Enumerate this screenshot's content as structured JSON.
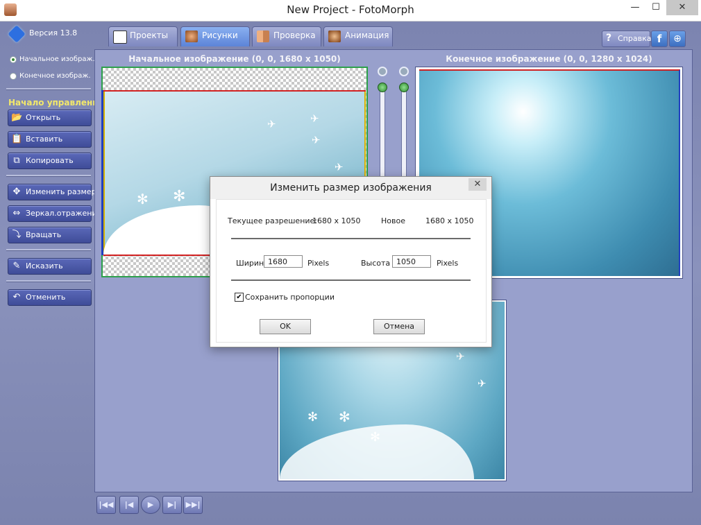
{
  "window": {
    "title": "New Project - FotoMorph",
    "minimize_glyph": "—",
    "maximize_glyph": "☐",
    "close_glyph": "✕"
  },
  "sidebar": {
    "version": "Версия 13.8",
    "radio_start": "Начальное изображ.",
    "radio_end": "Конечное изображ.",
    "selected_radio": "start",
    "controls_heading": "Начало управления",
    "buttons": {
      "open": "Открыть",
      "paste": "Вставить",
      "copy": "Копировать",
      "resize": "Изменить размер",
      "mirror": "Зеркал.отражение",
      "rotate": "Вращать",
      "distort": "Исказить",
      "undo": "Отменить"
    }
  },
  "tabs": {
    "projects": "Проекты",
    "images": "Рисунки",
    "preview": "Проверка",
    "animation": "Анимация",
    "active": "images"
  },
  "top_right": {
    "help": "Справка",
    "facebook_glyph": "f",
    "web_glyph": "⊕"
  },
  "panes": {
    "start_label": "Начальное изображение (0, 0, 1680 x 1050)",
    "end_label": "Конечное изображение (0, 0, 1280 x 1024)"
  },
  "playback": {
    "first": "|◀◀",
    "prev": "|◀",
    "play": "▶",
    "next": "▶|",
    "last": "▶▶|"
  },
  "dialog": {
    "title": "Изменить размер изображения",
    "close_glyph": "✕",
    "current_res_label": "Текущее разрешение:",
    "current_res_value": "1680 x 1050",
    "new_label": "Новое",
    "new_value": "1680 x 1050",
    "width_label": "Ширина",
    "width_value": "1680",
    "width_unit": "Pixels",
    "height_label": "Высота",
    "height_value": "1050",
    "height_unit": "Pixels",
    "keep_ratio_label": "Сохранить пропорции",
    "keep_ratio_checked": true,
    "ok": "OK",
    "cancel": "Отмена"
  },
  "colors": {
    "panel_bg": "#98a0cc",
    "sidebar_button": "#4a58a8",
    "heading_yellow": "#f2e86a",
    "start_frame_green": "#2ca04a"
  }
}
